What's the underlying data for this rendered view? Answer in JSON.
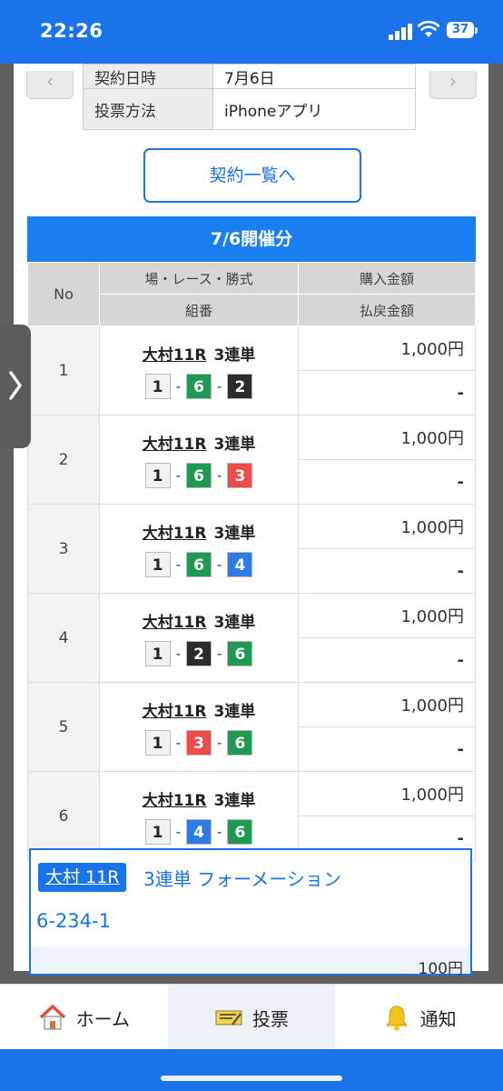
{
  "status_bar": {
    "time": "22:26",
    "battery": "37"
  },
  "contract_info": {
    "rows": [
      {
        "label": "契約日時",
        "value": "7月6日"
      },
      {
        "label": "投票方法",
        "value": "iPhoneアプリ"
      }
    ]
  },
  "list_button": "契約一覧へ",
  "section_title": "7/6開催分",
  "table": {
    "header_no": "No",
    "header_race": "場・レース・勝式",
    "header_combo": "組番",
    "header_purchase": "購入金額",
    "header_payout": "払戻金額",
    "rows": [
      {
        "no": "1",
        "venue": "大村11R",
        "type": "3連単",
        "combo": [
          "1",
          "6",
          "2"
        ],
        "amount": "1,000円",
        "payout": "-"
      },
      {
        "no": "2",
        "venue": "大村11R",
        "type": "3連単",
        "combo": [
          "1",
          "6",
          "3"
        ],
        "amount": "1,000円",
        "payout": "-"
      },
      {
        "no": "3",
        "venue": "大村11R",
        "type": "3連単",
        "combo": [
          "1",
          "6",
          "4"
        ],
        "amount": "1,000円",
        "payout": "-"
      },
      {
        "no": "4",
        "venue": "大村11R",
        "type": "3連単",
        "combo": [
          "1",
          "2",
          "6"
        ],
        "amount": "1,000円",
        "payout": "-"
      },
      {
        "no": "5",
        "venue": "大村11R",
        "type": "3連単",
        "combo": [
          "1",
          "3",
          "6"
        ],
        "amount": "1,000円",
        "payout": "-"
      },
      {
        "no": "6",
        "venue": "大村11R",
        "type": "3連単",
        "combo": [
          "1",
          "4",
          "6"
        ],
        "amount": "1,000円",
        "payout": "-"
      }
    ],
    "separator": "-"
  },
  "formation": {
    "badge": "大村 11R",
    "type": "3連単 フォーメーション",
    "combo": "6-234-1",
    "amount": "100円"
  },
  "boat_colors": {
    "1": {
      "bg": "#f2f2f2",
      "fg": "#222"
    },
    "2": {
      "bg": "#2b2b2b",
      "fg": "#ffffff"
    },
    "3": {
      "bg": "#ee4b4b",
      "fg": "#ffffff"
    },
    "4": {
      "bg": "#2f7be6",
      "fg": "#ffffff"
    },
    "5": {
      "bg": "#f3d431",
      "fg": "#222"
    },
    "6": {
      "bg": "#1e9a52",
      "fg": "#ffffff"
    }
  },
  "tabs": [
    {
      "label": "ホーム",
      "icon": "home-icon"
    },
    {
      "label": "投票",
      "icon": "ticket-icon"
    },
    {
      "label": "通知",
      "icon": "bell-icon"
    }
  ],
  "accent_color": "#1a73e8"
}
